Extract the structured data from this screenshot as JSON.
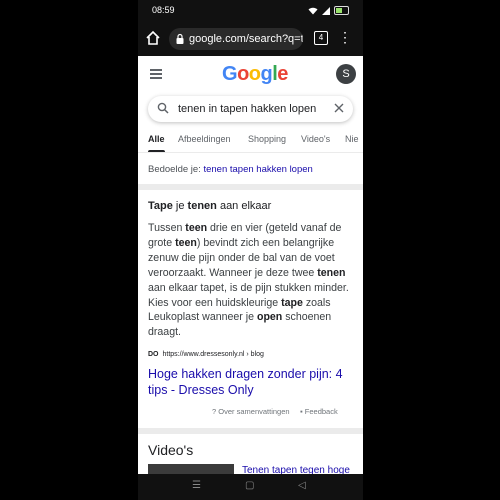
{
  "status": {
    "time": "08:59"
  },
  "browser": {
    "url": "google.com/search?q=te",
    "tab_count": "4"
  },
  "google": {
    "logo_letters": [
      {
        "char": "G",
        "color": "#4285F4"
      },
      {
        "char": "o",
        "color": "#EA4335"
      },
      {
        "char": "o",
        "color": "#FBBC05"
      },
      {
        "char": "g",
        "color": "#4285F4"
      },
      {
        "char": "l",
        "color": "#34A853"
      },
      {
        "char": "e",
        "color": "#EA4335"
      }
    ],
    "avatar_letter": "S",
    "query": "tenen in tapen hakken lopen"
  },
  "tabs": [
    "Alle",
    "Afbeeldingen",
    "Shopping",
    "Video's",
    "Nie"
  ],
  "did_you_mean": {
    "prefix": "Bedoelde je:",
    "suggestion": "tenen tapen hakken lopen"
  },
  "snippet": {
    "title_parts": [
      "Tape",
      " je ",
      "tenen",
      " aan elkaar"
    ],
    "body_parts": [
      "Tussen ",
      "teen",
      " drie en vier (geteld vanaf de grote ",
      "teen",
      ") bevindt zich een belangrijke zenuw die pijn onder de bal van de voet veroorzaakt. Wanneer je deze twee ",
      "tenen",
      " aan elkaar tapet, is de pijn stukken minder. Kies voor een huidskleurige ",
      "tape",
      " zoals Leukoplast wanneer je ",
      "open",
      " schoenen draagt."
    ],
    "source_favicon": "DO",
    "source_url": "https://www.dressesonly.nl › blog",
    "link_text": "Hoge hakken dragen zonder pijn: 4 tips - Dresses Only",
    "about_label": "Over samenvattingen",
    "feedback_label": "Feedback"
  },
  "videos": {
    "title": "Video's",
    "first_title": "Tenen tapen tegen hoge"
  },
  "navbar": {
    "recent": "☰",
    "home": "▢",
    "back": "◁"
  }
}
